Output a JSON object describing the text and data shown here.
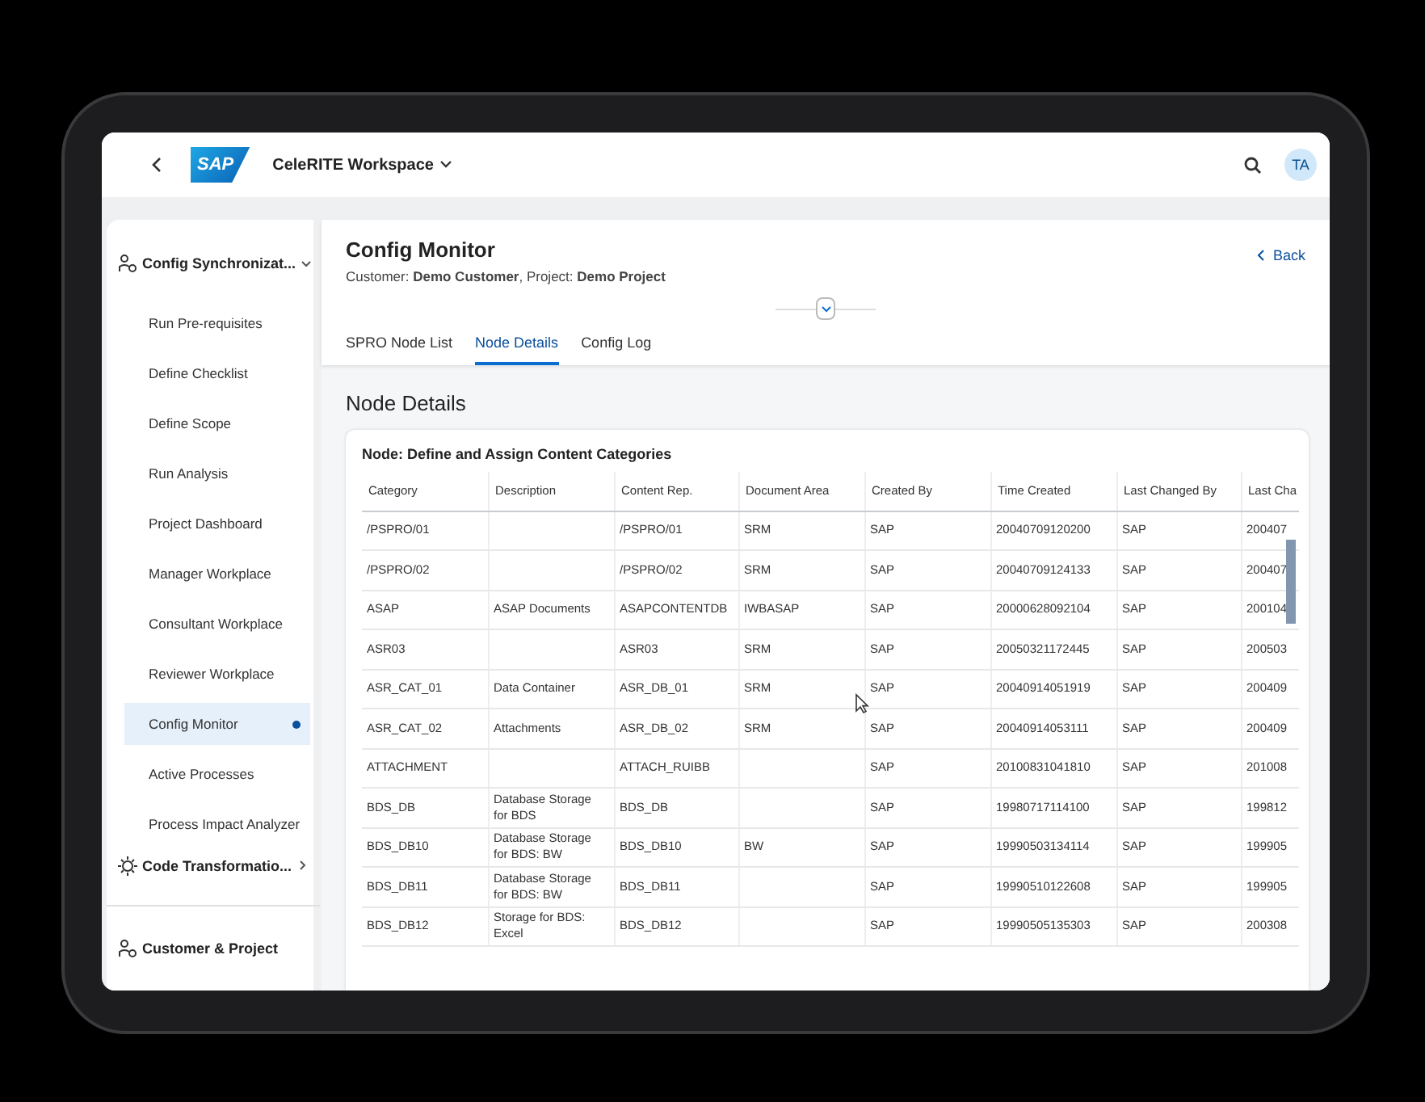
{
  "header": {
    "logo": "SAP",
    "workspace": "CeleRITE Workspace",
    "avatar": "TA"
  },
  "sidebar": {
    "groups": [
      {
        "label": "Config Synchronizat...",
        "expanded": true,
        "children": [
          {
            "label": "Run Pre-requisites",
            "selected": false
          },
          {
            "label": "Define Checklist",
            "selected": false
          },
          {
            "label": "Define Scope",
            "selected": false
          },
          {
            "label": "Run Analysis",
            "selected": false
          },
          {
            "label": "Project Dashboard",
            "selected": false
          },
          {
            "label": "Manager Workplace",
            "selected": false
          },
          {
            "label": "Consultant Workplace",
            "selected": false
          },
          {
            "label": "Reviewer Workplace",
            "selected": false
          },
          {
            "label": "Config Monitor",
            "selected": true
          },
          {
            "label": "Active Processes",
            "selected": false
          },
          {
            "label": "Process Impact Analyzer",
            "selected": false
          }
        ]
      },
      {
        "label": "Code Transformatio...",
        "expanded": false
      }
    ],
    "footer": "Customer & Project"
  },
  "page": {
    "title": "Config Monitor",
    "subtitle": "Customer: **Demo Customer**, Project: **Demo Project**",
    "back": "Back",
    "tabs": [
      {
        "label": "SPRO Node List",
        "selected": false
      },
      {
        "label": "Node Details",
        "selected": true
      },
      {
        "label": "Config Log",
        "selected": false
      }
    ],
    "section_title": "Node Details"
  },
  "card": {
    "title": "Node: Define and Assign Content Categories",
    "table": {
      "columns": [
        "Category",
        "Description",
        "Content Rep.",
        "Document Area",
        "Created By",
        "Time Created",
        "Last Changed By",
        "Last Cha"
      ],
      "rows": [
        [
          "/PSPRO/01",
          "",
          "/PSPRO/01",
          "SRM",
          "SAP",
          "20040709120200",
          "SAP",
          "200407"
        ],
        [
          "/PSPRO/02",
          "",
          "/PSPRO/02",
          "SRM",
          "SAP",
          "20040709124133",
          "SAP",
          "200407"
        ],
        [
          "ASAP",
          "ASAP Documents",
          "ASAPCONTENTDB",
          "IWBASAP",
          "SAP",
          "20000628092104",
          "SAP",
          "200104"
        ],
        [
          "ASR03",
          "",
          "ASR03",
          "SRM",
          "SAP",
          "20050321172445",
          "SAP",
          "200503"
        ],
        [
          "ASR_CAT_01",
          "Data Container",
          "ASR_DB_01",
          "SRM",
          "SAP",
          "20040914051919",
          "SAP",
          "200409"
        ],
        [
          "ASR_CAT_02",
          "Attachments",
          "ASR_DB_02",
          "SRM",
          "SAP",
          "20040914053111",
          "SAP",
          "200409"
        ],
        [
          "ATTACHMENT",
          "",
          "ATTACH_RUIBB",
          "",
          "SAP",
          "20100831041810",
          "SAP",
          "201008"
        ],
        [
          "BDS_DB",
          "Database Storage for BDS",
          "BDS_DB",
          "",
          "SAP",
          "19980717114100",
          "SAP",
          "199812"
        ],
        [
          "BDS_DB10",
          "Database Storage for BDS: BW",
          "BDS_DB10",
          "BW",
          "SAP",
          "19990503134114",
          "SAP",
          "199905"
        ],
        [
          "BDS_DB11",
          "Database Storage for BDS: BW",
          "BDS_DB11",
          "",
          "SAP",
          "19990510122608",
          "SAP",
          "199905"
        ],
        [
          "BDS_DB12",
          "Storage for BDS: Excel",
          "BDS_DB12",
          "",
          "SAP",
          "19990505135303",
          "SAP",
          "200308"
        ]
      ]
    }
  }
}
